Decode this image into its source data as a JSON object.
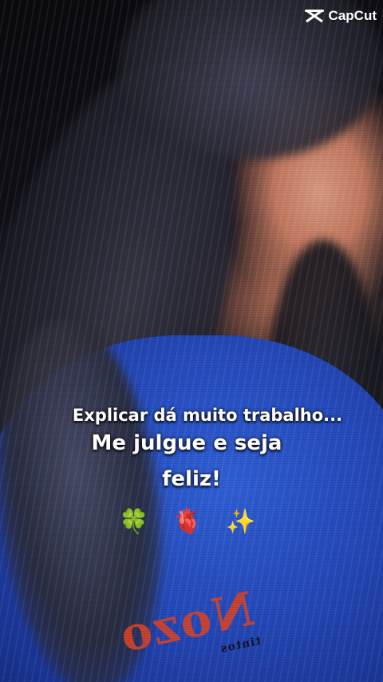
{
  "watermark": {
    "brand": "CapCut",
    "icon": "capcut-logo-icon"
  },
  "caption": {
    "line1": "Explicar dá muito trabalho...",
    "line2": "Me julgue e seja",
    "line3": "feliz!"
  },
  "emojis": [
    {
      "name": "four-leaf-clover-icon",
      "glyph": "🍀"
    },
    {
      "name": "anatomical-heart-icon",
      "glyph": "🫀"
    },
    {
      "name": "sparkles-icon",
      "glyph": "✨"
    }
  ],
  "shirt_print": {
    "text": "Nozo",
    "subtext": "tintos"
  },
  "colors": {
    "shirt_blue": "#2448b8",
    "caption_text": "#ffffff",
    "print_red": "#d6452a"
  }
}
